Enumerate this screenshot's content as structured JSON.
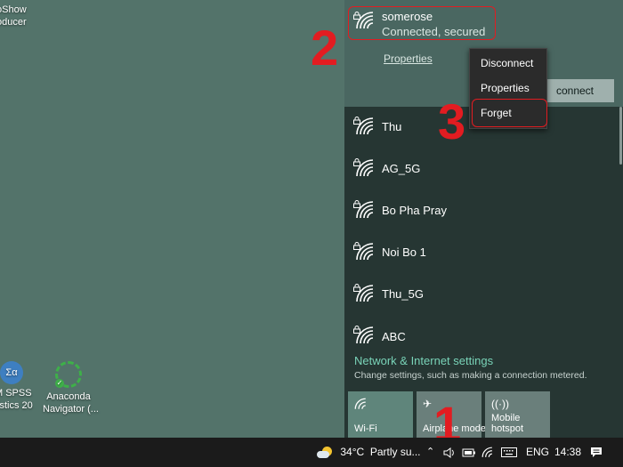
{
  "desktop": {
    "icons": [
      {
        "label": "oShow\noducer"
      },
      {
        "label": "M SPSS\ntistics 20"
      },
      {
        "label": "Anaconda\nNavigator (..."
      }
    ]
  },
  "network": {
    "connected": {
      "name": "somerose",
      "status": "Connected, secured",
      "properties_link": "Properties",
      "disconnect_button": "connect"
    },
    "networks": [
      {
        "name": "Thu"
      },
      {
        "name": "AG_5G"
      },
      {
        "name": "Bo Pha Pray"
      },
      {
        "name": "Noi Bo 1"
      },
      {
        "name": "Thu_5G"
      },
      {
        "name": "ABC"
      }
    ],
    "settings_link": "Network & Internet settings",
    "settings_sub": "Change settings, such as making a connection metered.",
    "quick_actions": [
      {
        "label": "Wi-Fi",
        "icon": "wifi-icon",
        "active": true
      },
      {
        "label": "Airplane mode",
        "icon": "airplane-icon",
        "active": false
      },
      {
        "label": "Mobile\nhotspot",
        "icon": "hotspot-icon",
        "active": false
      }
    ]
  },
  "context_menu": {
    "items": [
      {
        "label": "Disconnect"
      },
      {
        "label": "Properties"
      },
      {
        "label": "Forget"
      }
    ]
  },
  "annotations": {
    "step1": "1",
    "step2": "2",
    "step3": "3",
    "color": "#e21c21"
  },
  "taskbar": {
    "weather": "34°C  Partly su...",
    "language": "ENG",
    "time": "14:38"
  }
}
